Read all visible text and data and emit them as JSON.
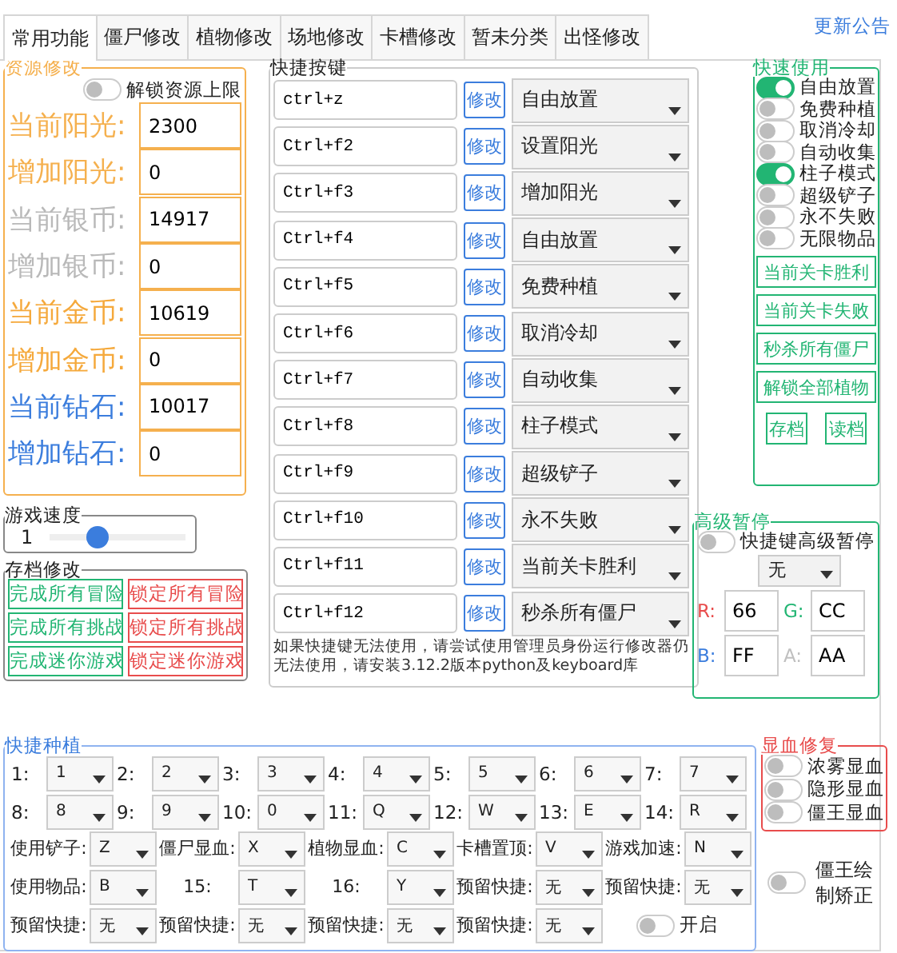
{
  "tabs": [
    {
      "label": "常用功能",
      "selected": true
    },
    {
      "label": "僵尸修改",
      "selected": false
    },
    {
      "label": "植物修改",
      "selected": false
    },
    {
      "label": "场地修改",
      "selected": false
    },
    {
      "label": "卡槽修改",
      "selected": false
    },
    {
      "label": "暂未分类",
      "selected": false
    },
    {
      "label": "出怪修改",
      "selected": false
    }
  ],
  "announcement_link": "更新公告",
  "resources": {
    "title": "资源修改",
    "unlock_toggle": {
      "label": "解锁资源上限",
      "on": false
    },
    "fields": [
      {
        "label": "当前阳光:",
        "value": "2300",
        "color": "#f5b04e"
      },
      {
        "label": "增加阳光:",
        "value": "0",
        "color": "#f5b04e"
      },
      {
        "label": "当前银币:",
        "value": "14917",
        "color": "#b9b9b9"
      },
      {
        "label": "增加银币:",
        "value": "0",
        "color": "#b9b9b9"
      },
      {
        "label": "当前金币:",
        "value": "10619",
        "color": "#f5a93c"
      },
      {
        "label": "增加金币:",
        "value": "0",
        "color": "#f5a93c"
      },
      {
        "label": "当前钻石:",
        "value": "10017",
        "color": "#3b7ddd"
      },
      {
        "label": "增加钻石:",
        "value": "0",
        "color": "#3b7ddd"
      }
    ]
  },
  "game_speed": {
    "title": "游戏速度",
    "value": "1",
    "level": 0.35
  },
  "save_edit": {
    "title": "存档修改",
    "buttons": [
      {
        "label": "完成所有冒险",
        "kind": "complete"
      },
      {
        "label": "锁定所有冒险",
        "kind": "lock"
      },
      {
        "label": "完成所有挑战",
        "kind": "complete"
      },
      {
        "label": "锁定所有挑战",
        "kind": "lock"
      },
      {
        "label": "完成迷你游戏",
        "kind": "complete"
      },
      {
        "label": "锁定迷你游戏",
        "kind": "lock"
      }
    ]
  },
  "hotkeys": {
    "title": "快捷按键",
    "rows": [
      {
        "key": "ctrl+z",
        "button": "修改",
        "action": "自由放置"
      },
      {
        "key": "Ctrl+f2",
        "button": "修改",
        "action": "设置阳光"
      },
      {
        "key": "Ctrl+f3",
        "button": "修改",
        "action": "增加阳光"
      },
      {
        "key": "Ctrl+f4",
        "button": "修改",
        "action": "自由放置"
      },
      {
        "key": "Ctrl+f5",
        "button": "修改",
        "action": "免费种植"
      },
      {
        "key": "Ctrl+f6",
        "button": "修改",
        "action": "取消冷却"
      },
      {
        "key": "Ctrl+f7",
        "button": "修改",
        "action": "自动收集"
      },
      {
        "key": "Ctrl+f8",
        "button": "修改",
        "action": "柱子模式"
      },
      {
        "key": "Ctrl+f9",
        "button": "修改",
        "action": "超级铲子"
      },
      {
        "key": "Ctrl+f10",
        "button": "修改",
        "action": "永不失败"
      },
      {
        "key": "Ctrl+f11",
        "button": "修改",
        "action": "当前关卡胜利"
      },
      {
        "key": "Ctrl+f12",
        "button": "修改",
        "action": "秒杀所有僵尸"
      }
    ],
    "note": "如果快捷键无法使用，请尝试使用管理员身份运行修改器仍无法使用，请安装3.12.2版本python及keyboard库"
  },
  "quick_use": {
    "title": "快速使用",
    "toggles": [
      {
        "label": "自由放置",
        "on": true
      },
      {
        "label": "免费种植",
        "on": false
      },
      {
        "label": "取消冷却",
        "on": false
      },
      {
        "label": "自动收集",
        "on": false
      },
      {
        "label": "柱子模式",
        "on": true
      },
      {
        "label": "超级铲子",
        "on": false
      },
      {
        "label": "永不失败",
        "on": false
      },
      {
        "label": "无限物品",
        "on": false
      }
    ],
    "buttons": [
      "当前关卡胜利",
      "当前关卡失败",
      "秒杀所有僵尸",
      "解锁全部植物"
    ],
    "small_buttons": [
      "存档",
      "读档"
    ]
  },
  "advanced_pause": {
    "title": "高级暂停",
    "toggle": {
      "label": "快捷键高级暂停",
      "on": false
    },
    "select": "无",
    "channels": [
      {
        "label": "R:",
        "value": "66",
        "color": "#e84c4c"
      },
      {
        "label": "G:",
        "value": "CC",
        "color": "#22b573"
      },
      {
        "label": "B:",
        "value": "FF",
        "color": "#3b7ddd"
      },
      {
        "label": "A:",
        "value": "AA",
        "color": "#c0c0c0"
      }
    ]
  },
  "quick_plant": {
    "title": "快捷种植",
    "slots": [
      {
        "label": "1:",
        "value": "1"
      },
      {
        "label": "2:",
        "value": "2"
      },
      {
        "label": "3:",
        "value": "3"
      },
      {
        "label": "4:",
        "value": "4"
      },
      {
        "label": "5:",
        "value": "5"
      },
      {
        "label": "6:",
        "value": "6"
      },
      {
        "label": "7:",
        "value": "7"
      },
      {
        "label": "8:",
        "value": "8"
      },
      {
        "label": "9:",
        "value": "9"
      },
      {
        "label": "10:",
        "value": "0"
      },
      {
        "label": "11:",
        "value": "Q"
      },
      {
        "label": "12:",
        "value": "W"
      },
      {
        "label": "13:",
        "value": "E"
      },
      {
        "label": "14:",
        "value": "R"
      }
    ],
    "bindings": [
      {
        "label": "使用铲子:",
        "value": "Z"
      },
      {
        "label": "僵尸显血:",
        "value": "X"
      },
      {
        "label": "植物显血:",
        "value": "C"
      },
      {
        "label": "卡槽置顶:",
        "value": "V"
      },
      {
        "label": "游戏加速:",
        "value": "N"
      },
      {
        "label": "使用物品:",
        "value": "B"
      },
      {
        "label": "15:",
        "value": "T"
      },
      {
        "label": "16:",
        "value": "Y"
      },
      {
        "label": "预留快捷:",
        "value": "无"
      },
      {
        "label": "预留快捷:",
        "value": "无"
      },
      {
        "label": "预留快捷:",
        "value": "无"
      },
      {
        "label": "预留快捷:",
        "value": "无"
      },
      {
        "label": "预留快捷:",
        "value": "无"
      },
      {
        "label": "预留快捷:",
        "value": "无"
      }
    ],
    "toggle": {
      "label": "开启",
      "on": false
    }
  },
  "health_fix": {
    "title": "显血修复",
    "toggles": [
      {
        "label": "浓雾显血",
        "on": false
      },
      {
        "label": "隐形显血",
        "on": false
      },
      {
        "label": "僵王显血",
        "on": false
      }
    ]
  },
  "boss_fix": {
    "label": "僵王绘制矫正",
    "on": false
  }
}
